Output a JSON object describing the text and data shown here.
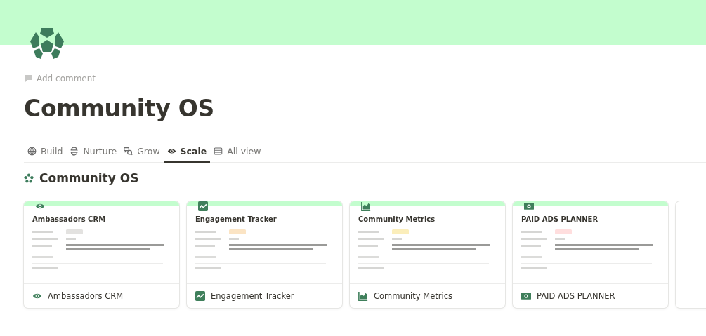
{
  "page": {
    "add_comment": "Add comment",
    "title": "Community OS"
  },
  "tabs": [
    {
      "label": "Build",
      "selected": false
    },
    {
      "label": "Nurture",
      "selected": false
    },
    {
      "label": "Grow",
      "selected": false
    },
    {
      "label": "Scale",
      "selected": true
    },
    {
      "label": "All view",
      "selected": false
    }
  ],
  "section": {
    "title": "Community OS"
  },
  "cards": [
    {
      "kind": "page",
      "title": "Ambassadors CRM",
      "preview_title": "Ambassadors CRM",
      "color": "#e3e2e0"
    },
    {
      "kind": "page",
      "title": "Engagement Tracker",
      "preview_title": "Engagement Tracker",
      "color": "#fbe4c4"
    },
    {
      "kind": "page",
      "title": "Community Metrics",
      "preview_title": "Community Metrics",
      "color": "#fbeebb"
    },
    {
      "kind": "page",
      "title": "PAID ADS PLANNER",
      "preview_title": "PAID ADS PLANNER",
      "color": "#ffdede"
    },
    {
      "kind": "empty"
    }
  ]
}
